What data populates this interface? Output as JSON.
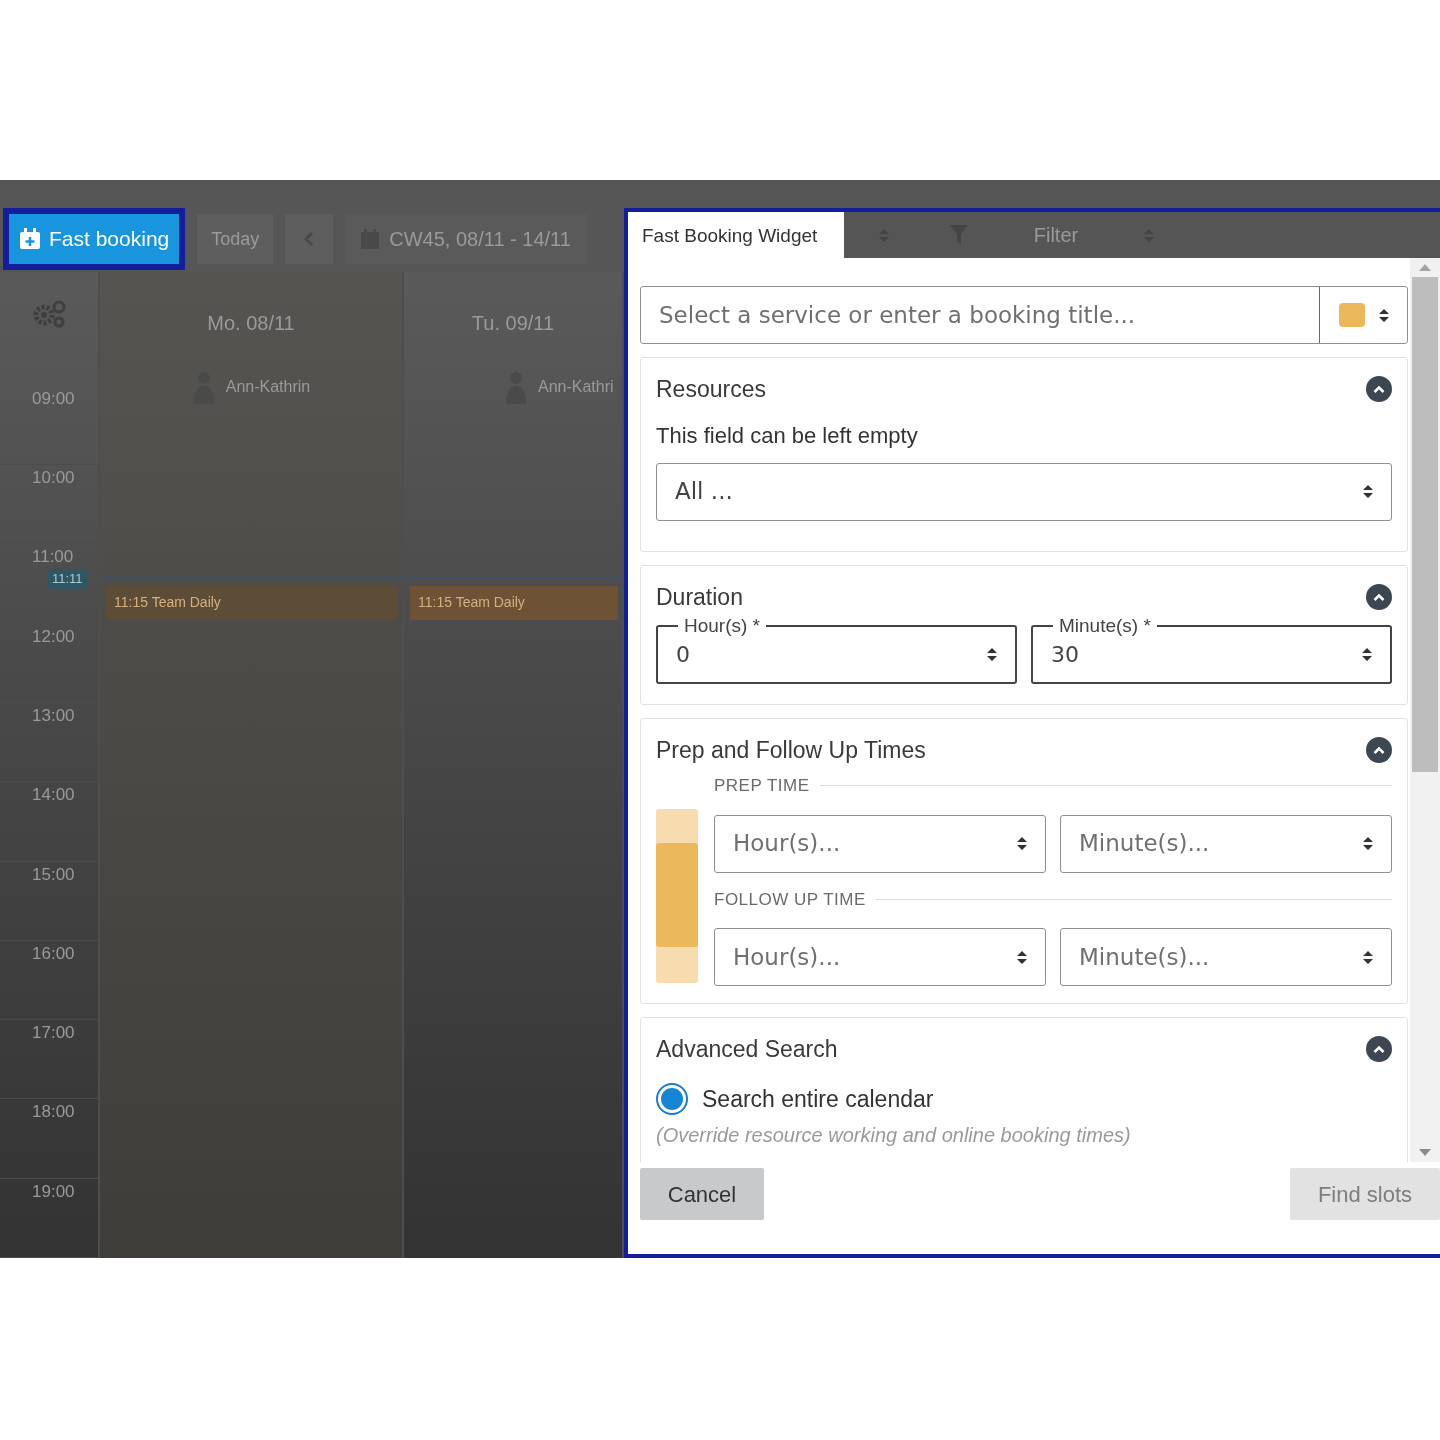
{
  "calendar": {
    "fast_booking_button": "Fast booking",
    "today_button": "Today",
    "week_range": "CW45, 08/11 - 14/11",
    "days": [
      {
        "label": "Mo. 08/11",
        "resource": "Ann-Kathrin",
        "event": "11:15 Team Daily"
      },
      {
        "label": "Tu. 09/11",
        "resource": "Ann-Kathri",
        "event": "11:15 Team Daily"
      }
    ],
    "times": [
      "09:00",
      "10:00",
      "11:00",
      "12:00",
      "13:00",
      "14:00",
      "15:00",
      "16:00",
      "17:00",
      "18:00",
      "19:00"
    ],
    "now_marker": "11:11"
  },
  "widget": {
    "tab": "Fast Booking Widget",
    "filter": "Filter",
    "service_field": {
      "placeholder": "Select a service or enter a booking title...",
      "color": "#ebb85c"
    },
    "resources": {
      "title": "Resources",
      "expanded": true,
      "hint": "This field can be left empty",
      "value": "All ..."
    },
    "duration": {
      "title": "Duration",
      "expanded": true,
      "hours": {
        "label": "Hour(s) *",
        "value": "0"
      },
      "minutes": {
        "label": "Minute(s) *",
        "value": "30"
      }
    },
    "prep_follow": {
      "title": "Prep and Follow Up Times",
      "expanded": true,
      "groups": [
        {
          "label": "PREP TIME",
          "hours_placeholder": "Hour(s)...",
          "minutes_placeholder": "Minute(s)..."
        },
        {
          "label": "FOLLOW UP TIME",
          "hours_placeholder": "Hour(s)...",
          "minutes_placeholder": "Minute(s)..."
        }
      ]
    },
    "advanced_search": {
      "title": "Advanced Search",
      "expanded": true,
      "option": {
        "label": "Search entire calendar",
        "checked": true
      },
      "note": "(Override resource working and online booking times)"
    },
    "buttons": {
      "cancel": {
        "label": "Cancel",
        "disabled": false
      },
      "find": {
        "label": "Find slots",
        "disabled": true
      }
    }
  }
}
